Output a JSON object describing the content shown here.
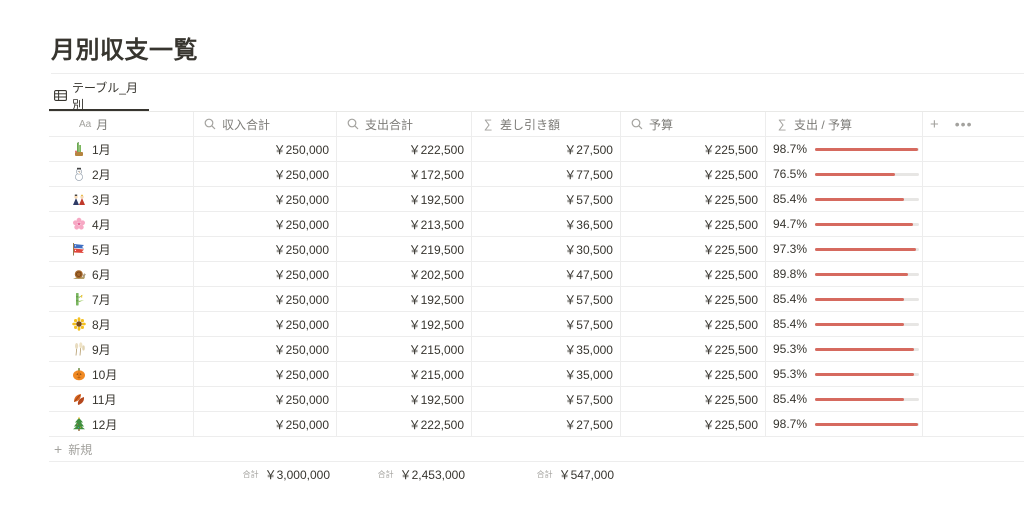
{
  "page": {
    "title": "月別収支一覧"
  },
  "view": {
    "tab_label": "テーブル_月別"
  },
  "table": {
    "columns": [
      {
        "label": "月",
        "icon": "text-title-icon"
      },
      {
        "label": "収入合計",
        "icon": "search-icon"
      },
      {
        "label": "支出合計",
        "icon": "search-icon"
      },
      {
        "label": "差し引き額",
        "icon": "sigma-icon"
      },
      {
        "label": "予算",
        "icon": "search-icon"
      },
      {
        "label": "支出 / 予算",
        "icon": "sigma-icon"
      }
    ],
    "add_column_icon": "plus-icon",
    "more_icon": "more-icon",
    "rows": [
      {
        "month": "1月",
        "emoji": "kadomatsu",
        "income": "￥250,000",
        "expense": "￥222,500",
        "diff": "￥27,500",
        "budget": "￥225,500",
        "ratio": "98.7%",
        "ratio_value": 0.987
      },
      {
        "month": "2月",
        "emoji": "snowman",
        "income": "￥250,000",
        "expense": "￥172,500",
        "diff": "￥77,500",
        "budget": "￥225,500",
        "ratio": "76.5%",
        "ratio_value": 0.765
      },
      {
        "month": "3月",
        "emoji": "hina-dolls",
        "income": "￥250,000",
        "expense": "￥192,500",
        "diff": "￥57,500",
        "budget": "￥225,500",
        "ratio": "85.4%",
        "ratio_value": 0.854
      },
      {
        "month": "4月",
        "emoji": "cherry-blossom",
        "income": "￥250,000",
        "expense": "￥213,500",
        "diff": "￥36,500",
        "budget": "￥225,500",
        "ratio": "94.7%",
        "ratio_value": 0.947
      },
      {
        "month": "5月",
        "emoji": "carp-streamer",
        "income": "￥250,000",
        "expense": "￥219,500",
        "diff": "￥30,500",
        "budget": "￥225,500",
        "ratio": "97.3%",
        "ratio_value": 0.973
      },
      {
        "month": "6月",
        "emoji": "snail",
        "income": "￥250,000",
        "expense": "￥202,500",
        "diff": "￥47,500",
        "budget": "￥225,500",
        "ratio": "89.8%",
        "ratio_value": 0.898
      },
      {
        "month": "7月",
        "emoji": "bamboo",
        "income": "￥250,000",
        "expense": "￥192,500",
        "diff": "￥57,500",
        "budget": "￥225,500",
        "ratio": "85.4%",
        "ratio_value": 0.854
      },
      {
        "month": "8月",
        "emoji": "sunflower",
        "income": "￥250,000",
        "expense": "￥192,500",
        "diff": "￥57,500",
        "budget": "￥225,500",
        "ratio": "85.4%",
        "ratio_value": 0.854
      },
      {
        "month": "9月",
        "emoji": "pampas-grass",
        "income": "￥250,000",
        "expense": "￥215,000",
        "diff": "￥35,000",
        "budget": "￥225,500",
        "ratio": "95.3%",
        "ratio_value": 0.953
      },
      {
        "month": "10月",
        "emoji": "pumpkin",
        "income": "￥250,000",
        "expense": "￥215,000",
        "diff": "￥35,000",
        "budget": "￥225,500",
        "ratio": "95.3%",
        "ratio_value": 0.953
      },
      {
        "month": "11月",
        "emoji": "fallen-leaf",
        "income": "￥250,000",
        "expense": "￥192,500",
        "diff": "￥57,500",
        "budget": "￥225,500",
        "ratio": "85.4%",
        "ratio_value": 0.854
      },
      {
        "month": "12月",
        "emoji": "christmas-tree",
        "income": "￥250,000",
        "expense": "￥222,500",
        "diff": "￥27,500",
        "budget": "￥225,500",
        "ratio": "98.7%",
        "ratio_value": 0.987
      }
    ],
    "new_row_label": "新規",
    "footer": {
      "income": {
        "label": "合計",
        "value": "￥3,000,000"
      },
      "expense": {
        "label": "合計",
        "value": "￥2,453,000"
      },
      "diff": {
        "label": "合計",
        "value": "￥547,000"
      }
    }
  },
  "colors": {
    "progress_fill": "#d66a5f",
    "progress_track": "#e7e6e4",
    "text": "#37352f",
    "muted": "#a3a29e"
  }
}
